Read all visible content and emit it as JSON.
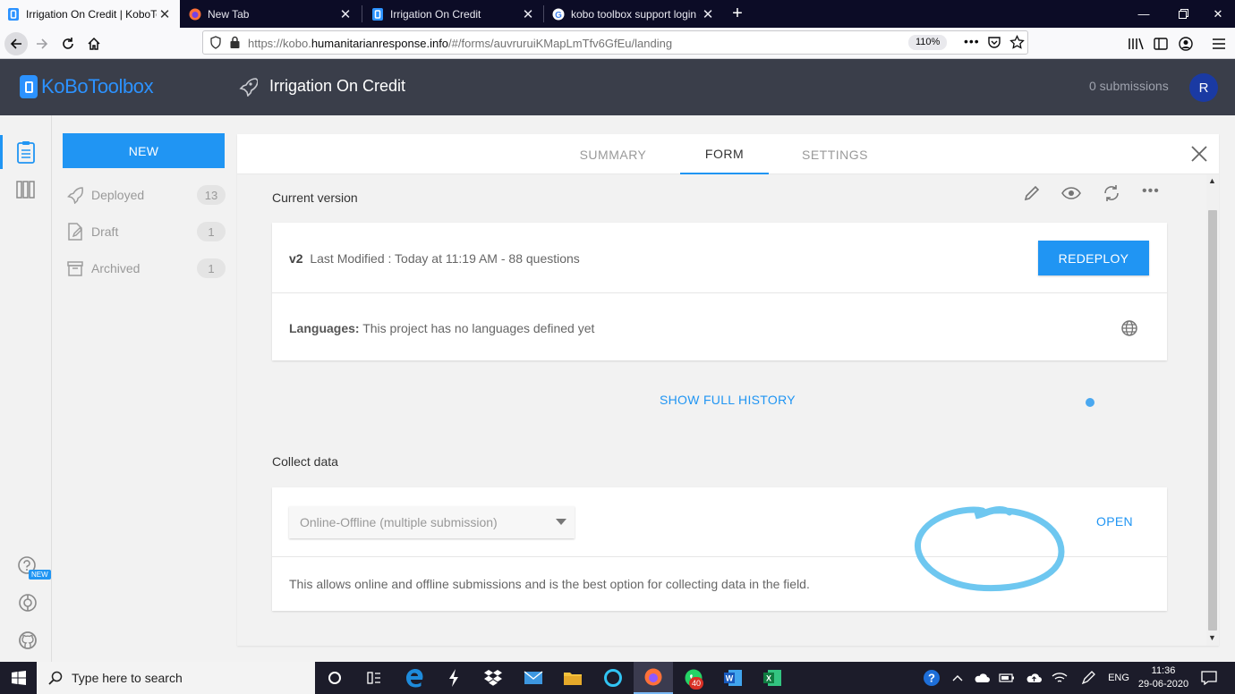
{
  "browser": {
    "tabs": [
      {
        "label": "Irrigation On Credit | KoboToolbox",
        "active": true,
        "icon": "kobo-favicon"
      },
      {
        "label": "New Tab",
        "active": false,
        "icon": "firefox-favicon"
      },
      {
        "label": "Irrigation On Credit",
        "active": false,
        "icon": "kobo-favicon"
      },
      {
        "label": "kobo toolbox support login - Google Search",
        "active": false,
        "icon": "google-favicon"
      }
    ],
    "url_prefix": "https://kobo.",
    "url_domain": "humanitarianresponse.info",
    "url_path": "/#/forms/auvruruiKMapLmTfv6GfEu/landing",
    "zoom": "110%"
  },
  "app": {
    "logo_text": "KoBoToolbox",
    "project_title": "Irrigation On Credit",
    "submissions": "0 submissions",
    "avatar_letter": "R",
    "accent_color": "#2095f3"
  },
  "sidebar": {
    "new_label": "NEW",
    "items": [
      {
        "label": "Deployed",
        "count": "13",
        "icon": "rocket-icon"
      },
      {
        "label": "Draft",
        "count": "1",
        "icon": "edit-icon"
      },
      {
        "label": "Archived",
        "count": "1",
        "icon": "archive-icon"
      }
    ],
    "help_badge": "NEW"
  },
  "page": {
    "tabs": [
      "SUMMARY",
      "FORM",
      "SETTINGS"
    ],
    "active_tab": "FORM",
    "current_version_title": "Current version",
    "version": "v2",
    "last_modified": "Last Modified : Today at 11:19 AM - 88 questions",
    "redeploy_label": "REDEPLOY",
    "languages_label": "Languages:",
    "languages_value": "This project has no languages defined yet",
    "history_label": "SHOW FULL HISTORY",
    "collect_title": "Collect data",
    "collect_option": "Online-Offline (multiple submission)",
    "open_label": "OPEN",
    "collect_description": "This allows online and offline submissions and is the best option for collecting data in the field."
  },
  "taskbar": {
    "search_placeholder": "Type here to search",
    "whatsapp_badge": "40",
    "language": "ENG",
    "time": "11:36",
    "date": "29-06-2020"
  }
}
